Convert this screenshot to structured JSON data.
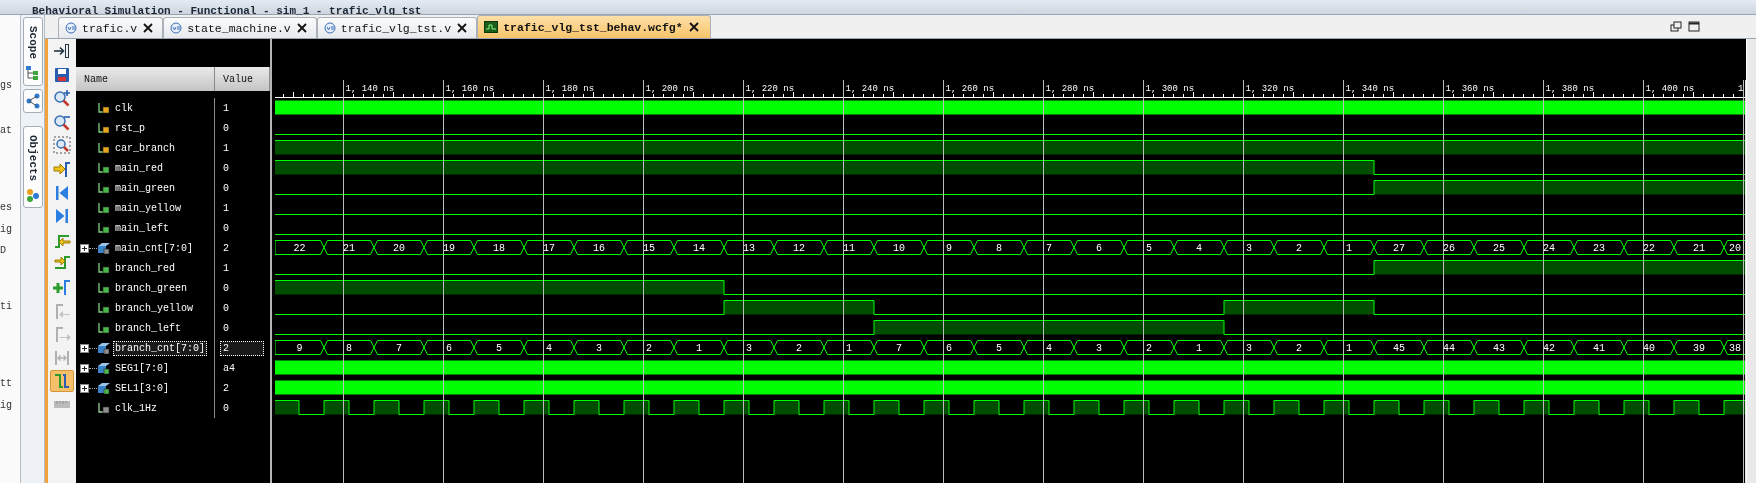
{
  "title_bar": {
    "title": "Behavioral Simulation - Functional - sim_1 - trafic_vlg_tst"
  },
  "left_panel": {
    "fragments": [
      "gs",
      "at",
      "es",
      "ig",
      "D",
      "ti",
      "tt",
      "ig"
    ]
  },
  "side_tabs": [
    {
      "kind": "labeled",
      "label": "Scope"
    },
    {
      "kind": "icon"
    },
    {
      "kind": "labeled",
      "label": "Objects"
    }
  ],
  "editor_tabs": [
    {
      "label": "trafic.v",
      "kind": "source",
      "selected": false
    },
    {
      "label": "state_machine.v",
      "kind": "source",
      "selected": false
    },
    {
      "label": "trafic_vlg_tst.v",
      "kind": "source",
      "selected": false
    },
    {
      "label": "trafic_vlg_tst_behav.wcfg*",
      "kind": "wave",
      "selected": true
    }
  ],
  "toolbar": [
    {
      "kind": "zoom-panel",
      "disabled": false,
      "selected": false
    },
    {
      "kind": "save",
      "disabled": false,
      "selected": false
    },
    {
      "kind": "zoom-in",
      "disabled": false,
      "selected": false
    },
    {
      "kind": "zoom-out",
      "disabled": false,
      "selected": false
    },
    {
      "kind": "zoom-fit",
      "disabled": false,
      "selected": false
    },
    {
      "kind": "go-cursor",
      "disabled": false,
      "selected": false
    },
    {
      "kind": "go-start",
      "disabled": false,
      "selected": false
    },
    {
      "kind": "go-end",
      "disabled": false,
      "selected": false
    },
    {
      "kind": "prev-edge",
      "disabled": false,
      "selected": false
    },
    {
      "kind": "next-edge",
      "disabled": false,
      "selected": false
    },
    {
      "kind": "add-marker",
      "disabled": false,
      "selected": false
    },
    {
      "kind": "prev-marker",
      "disabled": true,
      "selected": false
    },
    {
      "kind": "next-marker",
      "disabled": true,
      "selected": false
    },
    {
      "kind": "swap-cursors",
      "disabled": true,
      "selected": false
    },
    {
      "kind": "snap",
      "disabled": false,
      "selected": true
    },
    {
      "kind": "ruler",
      "disabled": true,
      "selected": false
    }
  ],
  "signal_table": {
    "columns": [
      "Name",
      "Value"
    ],
    "signals": [
      {
        "name": "clk",
        "value": "1",
        "kind": "input",
        "selected": false
      },
      {
        "name": "rst_p",
        "value": "0",
        "kind": "input",
        "selected": false
      },
      {
        "name": "car_branch",
        "value": "1",
        "kind": "input",
        "selected": false
      },
      {
        "name": "main_red",
        "value": "0",
        "kind": "output",
        "selected": false
      },
      {
        "name": "main_green",
        "value": "0",
        "kind": "output",
        "selected": false
      },
      {
        "name": "main_yellow",
        "value": "1",
        "kind": "output",
        "selected": false
      },
      {
        "name": "main_left",
        "value": "0",
        "kind": "output",
        "selected": false
      },
      {
        "name": "main_cnt[7:0]",
        "value": "2",
        "kind": "bus-internal",
        "selected": false,
        "trace_values": [
          "22",
          "21",
          "20",
          "19",
          "18",
          "17",
          "16",
          "15",
          "14",
          "13",
          "12",
          "11",
          "10",
          "9",
          "8",
          "7",
          "6",
          "5",
          "4",
          "3",
          "2",
          "1",
          "27",
          "26",
          "25",
          "24",
          "23",
          "22",
          "21",
          "20"
        ]
      },
      {
        "name": "branch_red",
        "value": "1",
        "kind": "output",
        "selected": false
      },
      {
        "name": "branch_green",
        "value": "0",
        "kind": "output",
        "selected": false
      },
      {
        "name": "branch_yellow",
        "value": "0",
        "kind": "output",
        "selected": false
      },
      {
        "name": "branch_left",
        "value": "0",
        "kind": "output",
        "selected": false
      },
      {
        "name": "branch_cnt[7:0]",
        "value": "2",
        "kind": "bus-internal",
        "selected": true,
        "trace_values": [
          "9",
          "8",
          "7",
          "6",
          "5",
          "4",
          "3",
          "2",
          "1",
          "3",
          "2",
          "1",
          "7",
          "6",
          "5",
          "4",
          "3",
          "2",
          "1",
          "3",
          "2",
          "1",
          "45",
          "44",
          "43",
          "42",
          "41",
          "40",
          "39",
          "38"
        ]
      },
      {
        "name": "SEG1[7:0]",
        "value": "a4",
        "kind": "bus-output",
        "selected": false
      },
      {
        "name": "SEL1[3:0]",
        "value": "2",
        "kind": "bus-output",
        "selected": false
      },
      {
        "name": "clk_1Hz",
        "value": "0",
        "kind": "internal",
        "selected": false
      }
    ]
  },
  "waveform": {
    "time_ruler": {
      "labels": [
        "1, 140 ns",
        "1, 160 ns",
        "1, 180 ns",
        "1, 200 ns",
        "1, 220 ns",
        "1, 240 ns",
        "1, 260 ns",
        "1, 280 ns",
        "1, 300 ns",
        "1, 320 ns",
        "1, 340 ns",
        "1, 360 ns",
        "1, 380 ns",
        "1, 400 ns",
        "1"
      ]
    }
  }
}
